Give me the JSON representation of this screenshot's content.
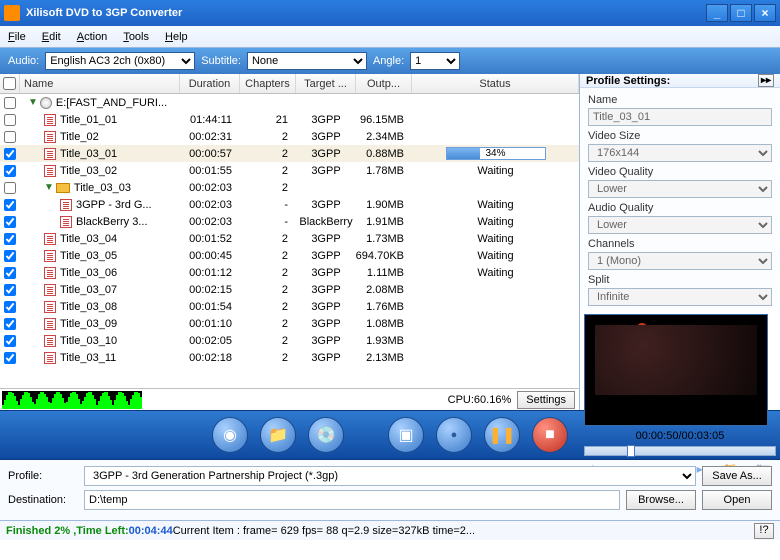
{
  "window": {
    "title": "Xilisoft DVD to 3GP Converter"
  },
  "menus": [
    "File",
    "Edit",
    "Action",
    "Tools",
    "Help"
  ],
  "options": {
    "audio_label": "Audio:",
    "audio_value": "English AC3 2ch (0x80)",
    "subtitle_label": "Subtitle:",
    "subtitle_value": "None",
    "angle_label": "Angle:",
    "angle_value": "1"
  },
  "columns": {
    "name": "Name",
    "duration": "Duration",
    "chapters": "Chapters",
    "target": "Target ...",
    "output": "Outp...",
    "status": "Status"
  },
  "rows": [
    {
      "ck": false,
      "depth": 0,
      "type": "disk",
      "name": "E:[FAST_AND_FURI...",
      "dur": "",
      "ch": "",
      "tgt": "",
      "out": "",
      "st": ""
    },
    {
      "ck": false,
      "depth": 1,
      "type": "file",
      "name": "Title_01_01",
      "dur": "01:44:11",
      "ch": "21",
      "tgt": "3GPP",
      "out": "96.15MB",
      "st": ""
    },
    {
      "ck": false,
      "depth": 1,
      "type": "file",
      "name": "Title_02",
      "dur": "00:02:31",
      "ch": "2",
      "tgt": "3GPP",
      "out": "2.34MB",
      "st": ""
    },
    {
      "ck": true,
      "depth": 1,
      "type": "file",
      "name": "Title_03_01",
      "dur": "00:00:57",
      "ch": "2",
      "tgt": "3GPP",
      "out": "0.88MB",
      "st": "progress",
      "pct": 34,
      "sel": true
    },
    {
      "ck": true,
      "depth": 1,
      "type": "file",
      "name": "Title_03_02",
      "dur": "00:01:55",
      "ch": "2",
      "tgt": "3GPP",
      "out": "1.78MB",
      "st": "Waiting"
    },
    {
      "ck": false,
      "depth": 1,
      "type": "folder",
      "name": "Title_03_03",
      "dur": "00:02:03",
      "ch": "2",
      "tgt": "",
      "out": "",
      "st": ""
    },
    {
      "ck": true,
      "depth": 2,
      "type": "file",
      "name": "3GPP - 3rd G...",
      "dur": "00:02:03",
      "ch": "-",
      "tgt": "3GPP",
      "out": "1.90MB",
      "st": "Waiting"
    },
    {
      "ck": true,
      "depth": 2,
      "type": "file",
      "name": "BlackBerry 3...",
      "dur": "00:02:03",
      "ch": "-",
      "tgt": "BlackBerry",
      "out": "1.91MB",
      "st": "Waiting"
    },
    {
      "ck": true,
      "depth": 1,
      "type": "file",
      "name": "Title_03_04",
      "dur": "00:01:52",
      "ch": "2",
      "tgt": "3GPP",
      "out": "1.73MB",
      "st": "Waiting"
    },
    {
      "ck": true,
      "depth": 1,
      "type": "file",
      "name": "Title_03_05",
      "dur": "00:00:45",
      "ch": "2",
      "tgt": "3GPP",
      "out": "694.70KB",
      "st": "Waiting"
    },
    {
      "ck": true,
      "depth": 1,
      "type": "file",
      "name": "Title_03_06",
      "dur": "00:01:12",
      "ch": "2",
      "tgt": "3GPP",
      "out": "1.11MB",
      "st": "Waiting"
    },
    {
      "ck": true,
      "depth": 1,
      "type": "file",
      "name": "Title_03_07",
      "dur": "00:02:15",
      "ch": "2",
      "tgt": "3GPP",
      "out": "2.08MB",
      "st": ""
    },
    {
      "ck": true,
      "depth": 1,
      "type": "file",
      "name": "Title_03_08",
      "dur": "00:01:54",
      "ch": "2",
      "tgt": "3GPP",
      "out": "1.76MB",
      "st": ""
    },
    {
      "ck": true,
      "depth": 1,
      "type": "file",
      "name": "Title_03_09",
      "dur": "00:01:10",
      "ch": "2",
      "tgt": "3GPP",
      "out": "1.08MB",
      "st": ""
    },
    {
      "ck": true,
      "depth": 1,
      "type": "file",
      "name": "Title_03_10",
      "dur": "00:02:05",
      "ch": "2",
      "tgt": "3GPP",
      "out": "1.93MB",
      "st": ""
    },
    {
      "ck": true,
      "depth": 1,
      "type": "file",
      "name": "Title_03_11",
      "dur": "00:02:18",
      "ch": "2",
      "tgt": "3GPP",
      "out": "2.13MB",
      "st": ""
    }
  ],
  "cpu": {
    "label": "CPU:60.16%",
    "settings": "Settings"
  },
  "side": {
    "title": "Profile Settings:",
    "name_label": "Name",
    "name_value": "Title_03_01",
    "vsize_label": "Video Size",
    "vsize_value": "176x144",
    "vq_label": "Video Quality",
    "vq_value": "Lower",
    "aq_label": "Audio Quality",
    "aq_value": "Lower",
    "ch_label": "Channels",
    "ch_value": "1 (Mono)",
    "split_label": "Split",
    "split_value": "Infinite"
  },
  "preview": {
    "time": "00:00:50/00:03:05"
  },
  "bottom": {
    "profile_label": "Profile:",
    "profile_value": "3GPP - 3rd Generation Partnership Project  (*.3gp)",
    "dest_label": "Destination:",
    "dest_value": "D:\\temp",
    "saveas": "Save As...",
    "browse": "Browse...",
    "open": "Open"
  },
  "status": {
    "finished": "Finished 2% ,Time Left: ",
    "timeleft": "00:04:44",
    "info": " Current Item : frame=  629 fps=  88 q=2.9 size=327kB time=2...",
    "help": "!?"
  }
}
